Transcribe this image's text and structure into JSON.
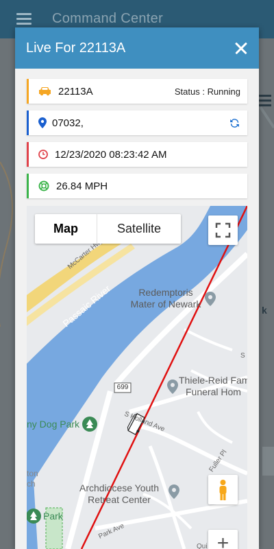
{
  "app": {
    "title": "Command Center"
  },
  "background": {
    "right_label": "k"
  },
  "modal": {
    "title": "Live For 22113A",
    "vehicle": {
      "id": "22113A",
      "status": "Status : Running"
    },
    "location": {
      "value": "07032,"
    },
    "datetime": {
      "value": "12/23/2020 08:23:42 AM"
    },
    "speed": {
      "value": "26.84 MPH"
    }
  },
  "map": {
    "tabs": [
      {
        "label": "Map",
        "active": true
      },
      {
        "label": "Satellite",
        "active": false
      }
    ],
    "labels": {
      "river": "Passaic River",
      "redemptoris_l1": "Redemptoris",
      "redemptoris_l2": "Mater of Newark",
      "thiele_l1": "Thiele-Reid Famil",
      "thiele_l2": "Funeral Hom",
      "dogpark": "ny Dog Park",
      "archdiocese_l1": "Archdiocese Youth",
      "archdiocese_l2": "Retreat Center",
      "park": "Park",
      "route": "699",
      "hollandave": "S Holland Ave",
      "fullerpl": "Fuller Pl",
      "parkave": "Park Ave",
      "mcarter": "McCarter Hwy",
      "left_frag1": "ton",
      "left_frag2": "ch",
      "s_frag": "S",
      "qui_frag": "Qui"
    },
    "zoom_in_label": "+"
  },
  "colors": {
    "header": "#3f8fc0",
    "vehicle_accent": "#f5a623",
    "location_accent": "#1a5fcf",
    "time_accent": "#e0434b",
    "speed_accent": "#3cb44b",
    "route_line": "#e01010",
    "water": "#77a8e0"
  }
}
